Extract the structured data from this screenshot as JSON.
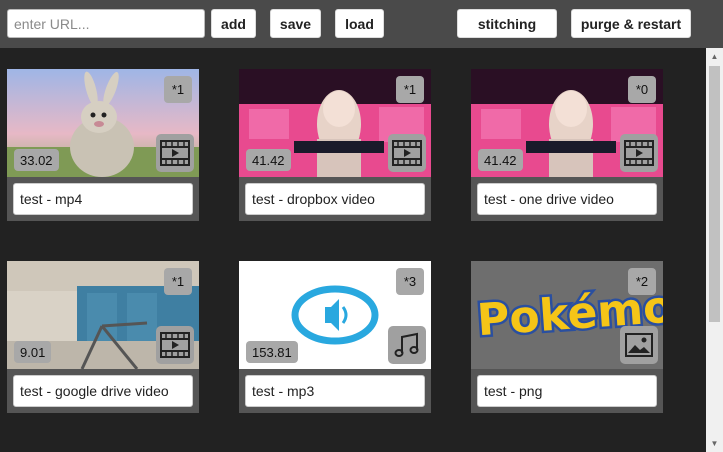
{
  "toolbar": {
    "url_placeholder": "enter URL...",
    "add_label": "add",
    "save_label": "save",
    "load_label": "load",
    "stitching_label": "stitching",
    "purge_label": "purge & restart"
  },
  "cards": [
    {
      "title": "test - mp4",
      "badge": "*1",
      "duration": "33.02",
      "type_icon": "film-icon"
    },
    {
      "title": "test - dropbox video",
      "badge": "*1",
      "duration": "41.42",
      "type_icon": "film-icon"
    },
    {
      "title": "test - one drive video",
      "badge": "*0",
      "duration": "41.42",
      "type_icon": "film-icon"
    },
    {
      "title": "test - google drive video",
      "badge": "*1",
      "duration": "9.01",
      "type_icon": "film-icon"
    },
    {
      "title": "test - mp3",
      "badge": "*3",
      "duration": "153.81",
      "type_icon": "music-note-icon"
    },
    {
      "title": "test - png",
      "badge": "*2",
      "duration": "",
      "type_icon": "image-icon"
    }
  ],
  "colors": {
    "background": "#222222",
    "toolbar": "#4a4a4a",
    "card": "#555555",
    "badge": "#a8a8a8"
  }
}
